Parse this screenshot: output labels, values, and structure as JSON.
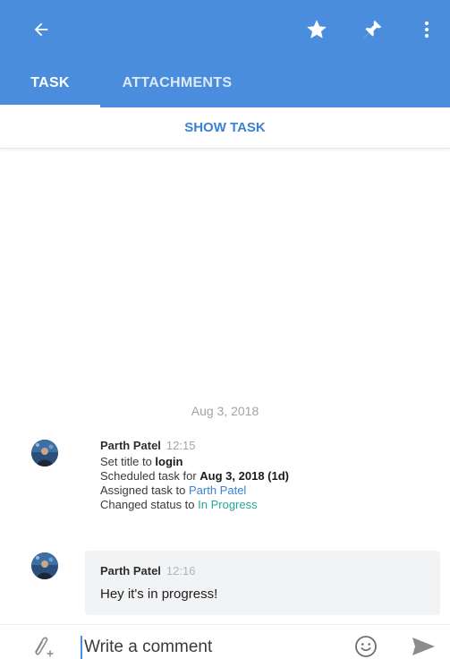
{
  "toolbar": {
    "back_icon": "arrow-left-icon",
    "star_icon": "star-icon",
    "pin_icon": "pin-icon",
    "more_icon": "more-vertical-icon",
    "color": "#4a8ddc"
  },
  "tabs": [
    {
      "label": "TASK",
      "active": true
    },
    {
      "label": "ATTACHMENTS",
      "active": false
    }
  ],
  "show_task": {
    "label": "SHOW TASK"
  },
  "timeline": {
    "date": "Aug 3, 2018",
    "activity": {
      "author": "Parth Patel",
      "time": "12:15",
      "lines": {
        "title_prefix": "Set title to ",
        "title_value": "login",
        "schedule_prefix": "Scheduled task for ",
        "schedule_value": "Aug 3, 2018 (1d)",
        "assign_prefix": "Assigned task to ",
        "assign_value": "Parth Patel",
        "status_prefix": "Changed status to ",
        "status_value": "In Progress"
      }
    },
    "comment": {
      "author": "Parth Patel",
      "time": "12:16",
      "text": "Hey it's in progress!"
    }
  },
  "composer": {
    "placeholder": "Write a comment",
    "attach_icon": "paperclip-icon",
    "emoji_icon": "emoji-icon",
    "send_icon": "send-icon"
  },
  "colors": {
    "accent": "#3b82d6",
    "status": "#25a69a"
  }
}
